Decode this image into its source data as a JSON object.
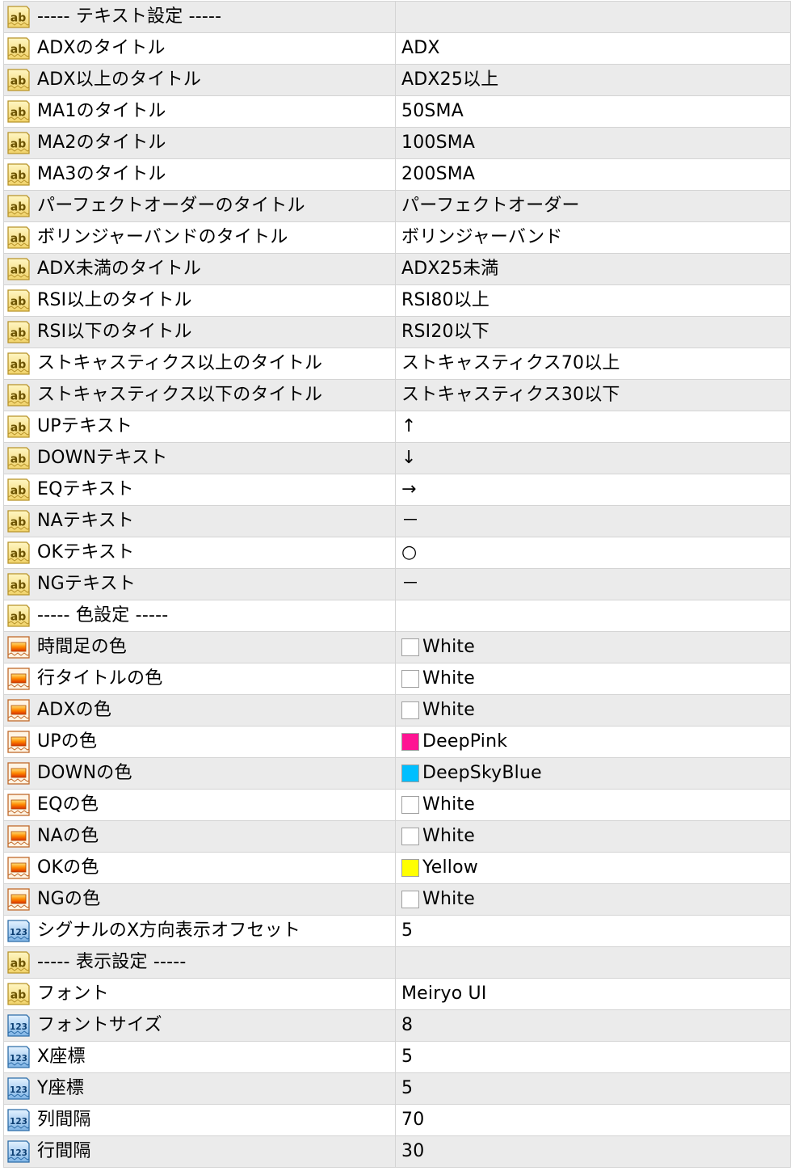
{
  "colors": {
    "row_odd": "#ebebeb",
    "row_even": "#ffffff",
    "grid_line": "#d4d4d4"
  },
  "rows": [
    {
      "icon": "string-ab-icon",
      "name": "----- テキスト設定 -----",
      "value": ""
    },
    {
      "icon": "string-ab-icon",
      "name": "ADXのタイトル",
      "value": "ADX"
    },
    {
      "icon": "string-ab-icon",
      "name": "ADX以上のタイトル",
      "value": "ADX25以上"
    },
    {
      "icon": "string-ab-icon",
      "name": "MA1のタイトル",
      "value": "50SMA"
    },
    {
      "icon": "string-ab-icon",
      "name": "MA2のタイトル",
      "value": "100SMA"
    },
    {
      "icon": "string-ab-icon",
      "name": "MA3のタイトル",
      "value": "200SMA"
    },
    {
      "icon": "string-ab-icon",
      "name": "パーフェクトオーダーのタイトル",
      "value": "パーフェクトオーダー"
    },
    {
      "icon": "string-ab-icon",
      "name": "ボリンジャーバンドのタイトル",
      "value": "ボリンジャーバンド"
    },
    {
      "icon": "string-ab-icon",
      "name": "ADX未満のタイトル",
      "value": "ADX25未満"
    },
    {
      "icon": "string-ab-icon",
      "name": "RSI以上のタイトル",
      "value": "RSI80以上"
    },
    {
      "icon": "string-ab-icon",
      "name": "RSI以下のタイトル",
      "value": "RSI20以下"
    },
    {
      "icon": "string-ab-icon",
      "name": "ストキャスティクス以上のタイトル",
      "value": "ストキャスティクス70以上"
    },
    {
      "icon": "string-ab-icon",
      "name": "ストキャスティクス以下のタイトル",
      "value": "ストキャスティクス30以下"
    },
    {
      "icon": "string-ab-icon",
      "name": "UPテキスト",
      "value": "↑"
    },
    {
      "icon": "string-ab-icon",
      "name": "DOWNテキスト",
      "value": "↓"
    },
    {
      "icon": "string-ab-icon",
      "name": "EQテキスト",
      "value": "→"
    },
    {
      "icon": "string-ab-icon",
      "name": "NAテキスト",
      "value": "－"
    },
    {
      "icon": "string-ab-icon",
      "name": "OKテキスト",
      "value": "○"
    },
    {
      "icon": "string-ab-icon",
      "name": "NGテキスト",
      "value": "－"
    },
    {
      "icon": "string-ab-icon",
      "name": "----- 色設定 -----",
      "value": ""
    },
    {
      "icon": "color-icon",
      "name": "時間足の色",
      "value": "White",
      "swatch": "#ffffff"
    },
    {
      "icon": "color-icon",
      "name": "行タイトルの色",
      "value": "White",
      "swatch": "#ffffff"
    },
    {
      "icon": "color-icon",
      "name": "ADXの色",
      "value": "White",
      "swatch": "#ffffff"
    },
    {
      "icon": "color-icon",
      "name": "UPの色",
      "value": "DeepPink",
      "swatch": "#ff1493"
    },
    {
      "icon": "color-icon",
      "name": "DOWNの色",
      "value": "DeepSkyBlue",
      "swatch": "#00bfff"
    },
    {
      "icon": "color-icon",
      "name": "EQの色",
      "value": "White",
      "swatch": "#ffffff"
    },
    {
      "icon": "color-icon",
      "name": "NAの色",
      "value": "White",
      "swatch": "#ffffff"
    },
    {
      "icon": "color-icon",
      "name": "OKの色",
      "value": "Yellow",
      "swatch": "#ffff00"
    },
    {
      "icon": "color-icon",
      "name": "NGの色",
      "value": "White",
      "swatch": "#ffffff"
    },
    {
      "icon": "integer-123-icon",
      "name": "シグナルのX方向表示オフセット",
      "value": "5"
    },
    {
      "icon": "string-ab-icon",
      "name": "----- 表示設定 -----",
      "value": ""
    },
    {
      "icon": "string-ab-icon",
      "name": "フォント",
      "value": "Meiryo UI"
    },
    {
      "icon": "integer-123-icon",
      "name": "フォントサイズ",
      "value": "8"
    },
    {
      "icon": "integer-123-icon",
      "name": "X座標",
      "value": "5"
    },
    {
      "icon": "integer-123-icon",
      "name": "Y座標",
      "value": "5"
    },
    {
      "icon": "integer-123-icon",
      "name": "列間隔",
      "value": "70"
    },
    {
      "icon": "integer-123-icon",
      "name": "行間隔",
      "value": "30"
    }
  ]
}
